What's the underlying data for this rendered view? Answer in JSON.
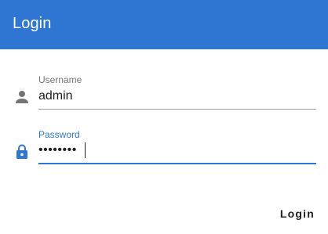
{
  "dialog": {
    "title": "Login",
    "header_color": "#2f76d2"
  },
  "fields": {
    "username": {
      "label": "Username",
      "value": "admin",
      "icon": "person-icon"
    },
    "password": {
      "label": "Password",
      "masked_value": "••••••••",
      "icon": "lock-icon",
      "focused": true
    }
  },
  "actions": {
    "login_label": "Login"
  }
}
